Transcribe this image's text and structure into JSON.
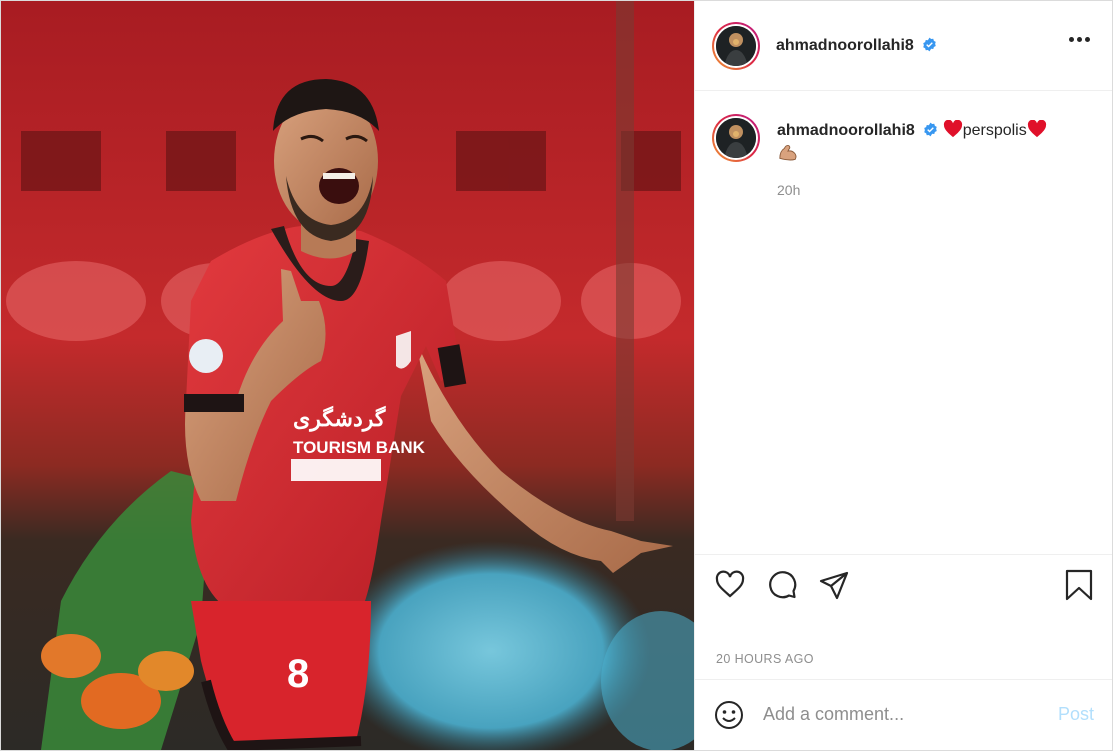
{
  "post": {
    "username": "ahmadnoorollahi8",
    "verified": true,
    "colors": {
      "verified_badge": "#3897f0",
      "heart": "#e0102a",
      "post_button_disabled": "#b2dffc"
    }
  },
  "media": {
    "jersey_number": "8",
    "sponsor_text": "TOURISM BANK"
  },
  "caption": {
    "username": "ahmadnoorollahi8",
    "text": "perspolis",
    "time": "20h"
  },
  "actions": {
    "icons": [
      "heart-icon",
      "comment-icon",
      "share-icon",
      "bookmark-icon"
    ]
  },
  "timestamp": "20 HOURS AGO",
  "add_comment": {
    "placeholder": "Add a comment...",
    "post_label": "Post"
  }
}
